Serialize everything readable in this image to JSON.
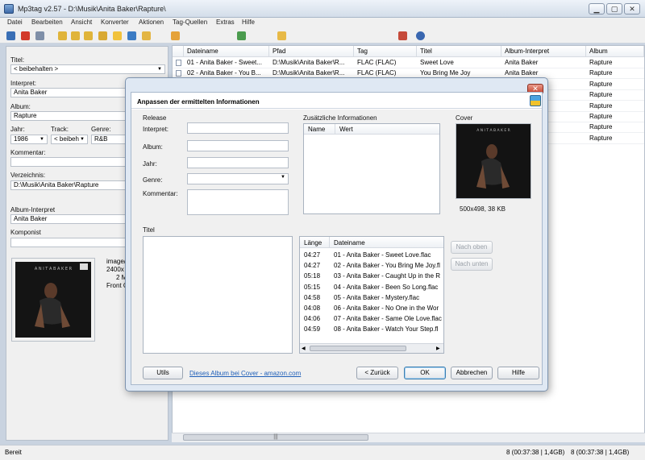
{
  "window": {
    "title": "Mp3tag v2.57  -  D:\\Musik\\Anita Baker\\Rapture\\",
    "btn_minimize": "▁",
    "btn_maximize": "▢",
    "btn_close": "✕"
  },
  "menu": [
    "Datei",
    "Bearbeiten",
    "Ansicht",
    "Konverter",
    "Aktionen",
    "Tag-Quellen",
    "Extras",
    "Hilfe"
  ],
  "toolbar_icons": [
    "save-icon",
    "delete-icon",
    "undo-icon",
    "add-folder-icon",
    "change-dir-icon",
    "refresh-icon",
    "favorite-icon",
    "reload-icon",
    "tag-file-icon",
    "file-tag-icon",
    "tag-source-icon",
    "actions-icon",
    "convert-icon",
    "options-icon",
    "help-icon"
  ],
  "tag_panel": {
    "titel_label": "Titel:",
    "titel_value": "< beibehalten >",
    "interpret_label": "Interpret:",
    "interpret_value": "Anita Baker",
    "album_label": "Album:",
    "album_value": "Rapture",
    "jahr_label": "Jahr:",
    "jahr_value": "1986",
    "track_label": "Track:",
    "track_value": "< beibeh",
    "genre_label": "Genre:",
    "genre_value": "R&B",
    "kommentar_label": "Kommentar:",
    "kommentar_value": "",
    "verzeichnis_label": "Verzeichnis:",
    "verzeichnis_value": "D:\\Musik\\Anita Baker\\Rapture",
    "album_interpret_label": "Album-Interpret",
    "album_interpret_value": "Anita Baker",
    "komponist_label": "Komponist",
    "komponist_value": "",
    "cover_info": [
      "image/",
      "2400x",
      "2 M",
      "Front C"
    ]
  },
  "file_list": {
    "columns": [
      "Dateiname",
      "Pfad",
      "Tag",
      "Titel",
      "Album-Interpret",
      "Album"
    ],
    "rows": [
      {
        "dateiname": "01 - Anita Baker - Sweet...",
        "pfad": "D:\\Musik\\Anita Baker\\R...",
        "tag": "FLAC (FLAC)",
        "titel": "Sweet Love",
        "album_interpret": "Anita Baker",
        "album": "Rapture"
      },
      {
        "dateiname": "02 - Anita Baker - You B...",
        "pfad": "D:\\Musik\\Anita Baker\\R...",
        "tag": "FLAC (FLAC)",
        "titel": "You Bring Me Joy",
        "album_interpret": "Anita Baker",
        "album": "Rapture"
      },
      {
        "dateiname": "",
        "pfad": "",
        "tag": "",
        "titel": "",
        "album_interpret": "",
        "album": "Rapture"
      },
      {
        "dateiname": "",
        "pfad": "",
        "tag": "",
        "titel": "",
        "album_interpret": "",
        "album": "Rapture"
      },
      {
        "dateiname": "",
        "pfad": "",
        "tag": "",
        "titel": "",
        "album_interpret": "",
        "album": "Rapture"
      },
      {
        "dateiname": "",
        "pfad": "",
        "tag": "",
        "titel": "",
        "album_interpret": "",
        "album": "Rapture"
      },
      {
        "dateiname": "",
        "pfad": "",
        "tag": "",
        "titel": "",
        "album_interpret": "",
        "album": "Rapture"
      },
      {
        "dateiname": "",
        "pfad": "",
        "tag": "",
        "titel": "",
        "album_interpret": "",
        "album": "Rapture"
      }
    ]
  },
  "status": {
    "left": "Bereit",
    "mid": "8 (00:37:38 | 1,4GB)",
    "right": "8 (00:37:38 | 1,4GB)"
  },
  "dialog": {
    "title": "Anpassen der ermittelten Informationen",
    "release_label": "Release",
    "interpret_label": "Interpret:",
    "album_label": "Album:",
    "jahr_label": "Jahr:",
    "genre_label": "Genre:",
    "kommentar_label": "Kommentar:",
    "zusatz_label": "Zusätzliche Informationen",
    "col_name": "Name",
    "col_wert": "Wert",
    "cover_label": "Cover",
    "cover_info": "500x498, 38 KB",
    "titel_label": "Titel",
    "col_laenge": "Länge",
    "col_dateiname": "Dateiname",
    "tracks": [
      {
        "len": "04:27",
        "name": "01 - Anita Baker - Sweet Love.flac"
      },
      {
        "len": "04:27",
        "name": "02 - Anita Baker - You Bring Me Joy.fl"
      },
      {
        "len": "05:18",
        "name": "03 - Anita Baker - Caught Up in the R"
      },
      {
        "len": "05:15",
        "name": "04 - Anita Baker - Been So Long.flac"
      },
      {
        "len": "04:58",
        "name": "05 - Anita Baker - Mystery.flac"
      },
      {
        "len": "04:08",
        "name": "06 - Anita Baker - No One in the Wor"
      },
      {
        "len": "04:06",
        "name": "07 - Anita Baker - Same Ole Love.flac"
      },
      {
        "len": "04:59",
        "name": "08 - Anita Baker - Watch Your Step.fl"
      }
    ],
    "btn_nach_oben": "Nach oben",
    "btn_nach_unten": "Nach unten",
    "btn_utils": "Utils",
    "amazon_link": "Dieses Album bei Cover - amazon.com",
    "btn_zurueck": "< Zurück",
    "btn_ok": "OK",
    "btn_abbrechen": "Abbrechen",
    "btn_hilfe": "Hilfe"
  }
}
